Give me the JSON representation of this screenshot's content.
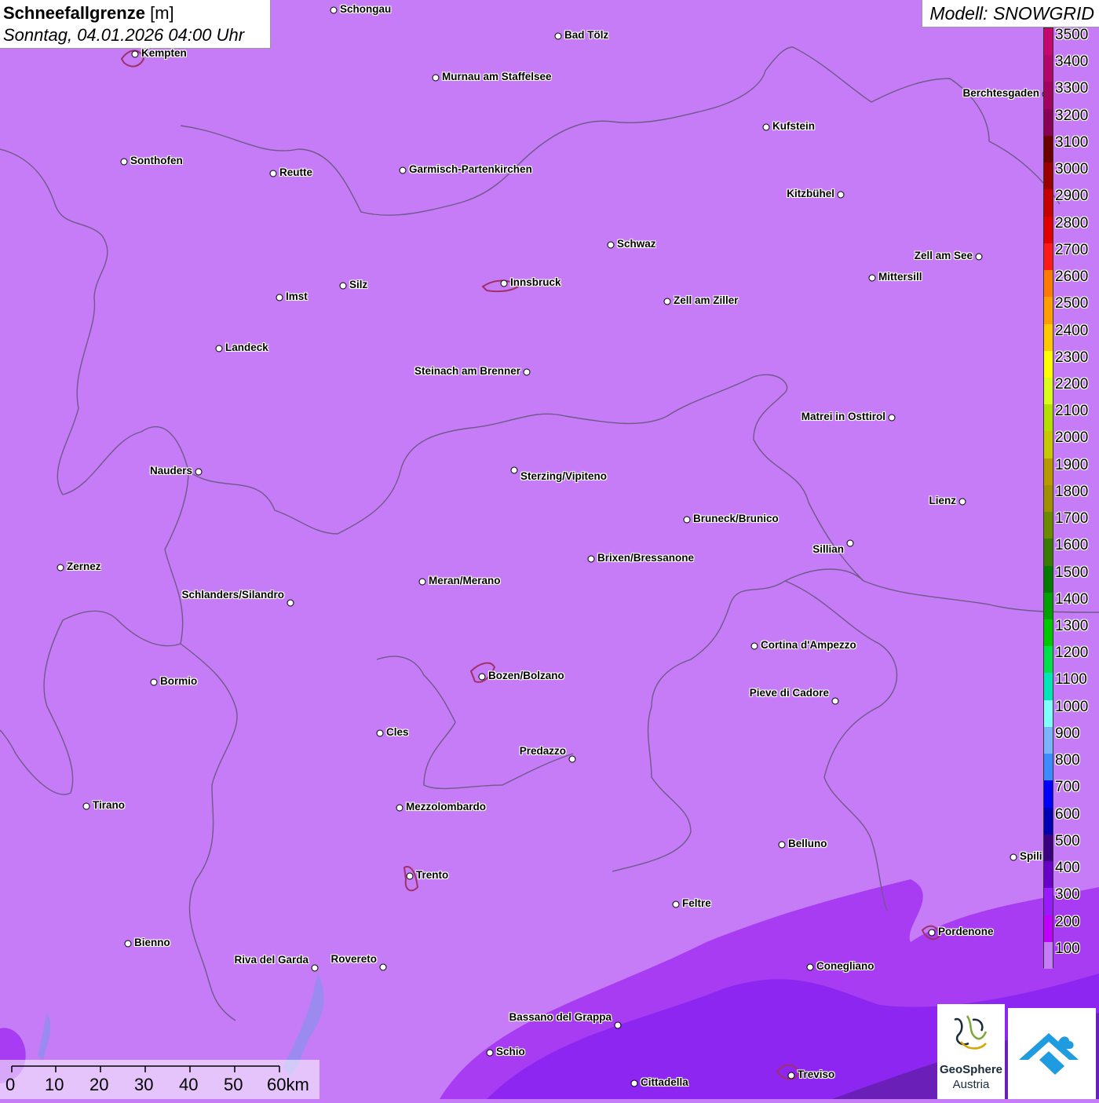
{
  "header": {
    "parameter": "Schneefallgrenze",
    "unit": "[m]",
    "datetime": "Sonntag, 04.01.2026 04:00 Uhr"
  },
  "model": {
    "label": "Modell: SNOWGRID"
  },
  "legend": {
    "labels": [
      "3500",
      "3400",
      "3300",
      "3200",
      "3100",
      "3000",
      "2900",
      "2800",
      "2700",
      "2600",
      "2500",
      "2400",
      "2300",
      "2200",
      "2100",
      "2000",
      "1900",
      "1800",
      "1700",
      "1600",
      "1500",
      "1400",
      "1300",
      "1200",
      "1100",
      "1000",
      "900",
      "800",
      "700",
      "600",
      "500",
      "400",
      "300",
      "200",
      "100"
    ],
    "colors": [
      "#c8076e",
      "#b40569",
      "#a2035f",
      "#8a0055",
      "#6a0000",
      "#9a0000",
      "#c40000",
      "#e00000",
      "#ff1a1a",
      "#ff7a00",
      "#ff9e00",
      "#ffc800",
      "#ffff00",
      "#d9ff1a",
      "#b4e000",
      "#c8c800",
      "#b89a00",
      "#a09000",
      "#6a8a00",
      "#3a7a00",
      "#007a00",
      "#00a000",
      "#00c800",
      "#00e04a",
      "#00e6b4",
      "#80ffff",
      "#7ab4ff",
      "#3a8cff",
      "#0000ff",
      "#0000b4",
      "#3a0080",
      "#6a00c8",
      "#9a1aff",
      "#c000ff",
      "#c67cf6"
    ]
  },
  "cities": [
    {
      "name": "Schongau"
    },
    {
      "name": "Kempten"
    },
    {
      "name": "Bad Tölz"
    },
    {
      "name": "Murnau am Staffelsee"
    },
    {
      "name": "Berchtesgaden"
    },
    {
      "name": "Kufstein"
    },
    {
      "name": "Sonthofen"
    },
    {
      "name": "Reutte"
    },
    {
      "name": "Garmisch-Partenkirchen"
    },
    {
      "name": "Kitzbühel"
    },
    {
      "name": "Schwaz"
    },
    {
      "name": "Zell am See"
    },
    {
      "name": "Innsbruck"
    },
    {
      "name": "Mittersill"
    },
    {
      "name": "Imst"
    },
    {
      "name": "Silz"
    },
    {
      "name": "Zell am Ziller"
    },
    {
      "name": "Landeck"
    },
    {
      "name": "Steinach am Brenner"
    },
    {
      "name": "Matrei in Osttirol"
    },
    {
      "name": "Nauders"
    },
    {
      "name": "Sterzing/Vipiteno"
    },
    {
      "name": "Lienz"
    },
    {
      "name": "Bruneck/Brunico"
    },
    {
      "name": "Sillian"
    },
    {
      "name": "Zernez"
    },
    {
      "name": "Brixen/Bressanone"
    },
    {
      "name": "Meran/Merano"
    },
    {
      "name": "Schlanders/Silandro"
    },
    {
      "name": "Cortina d'Ampezzo"
    },
    {
      "name": "Bozen/Bolzano"
    },
    {
      "name": "Bormio"
    },
    {
      "name": "Pieve di Cadore"
    },
    {
      "name": "Cles"
    },
    {
      "name": "Predazzo"
    },
    {
      "name": "Tirano"
    },
    {
      "name": "Mezzolombardo"
    },
    {
      "name": "Belluno"
    },
    {
      "name": "Spili"
    },
    {
      "name": "Trento"
    },
    {
      "name": "Feltre"
    },
    {
      "name": "Pordenone"
    },
    {
      "name": "Bienno"
    },
    {
      "name": "Riva del Garda"
    },
    {
      "name": "Rovereto"
    },
    {
      "name": "Conegliano"
    },
    {
      "name": "Bassano del Grappa"
    },
    {
      "name": "Schio"
    },
    {
      "name": "Treviso"
    },
    {
      "name": "Cittadella"
    }
  ],
  "scale": {
    "labels": [
      "0",
      "10",
      "20",
      "30",
      "40",
      "50",
      "60km"
    ]
  },
  "logos": {
    "geosphere_line1": "GeoSphere",
    "geosphere_line2": "Austria"
  }
}
